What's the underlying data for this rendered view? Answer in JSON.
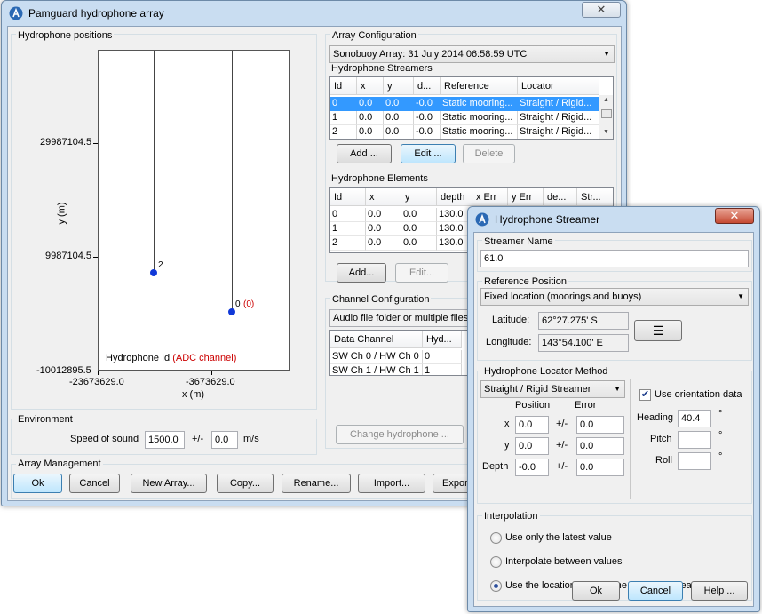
{
  "main_window": {
    "title": "Pamguard hydrophone array",
    "close_glyph": "✕",
    "hydrophone_positions": {
      "group_label": "Hydrophone positions",
      "y_ticks": [
        "29987104.5",
        "9987104.5",
        "-10012895.5"
      ],
      "x_ticks": [
        "-23673629.0",
        "-3673629.0"
      ],
      "ylabel": "y (m)",
      "xlabel": "x (m)",
      "legend_prefix": "Hydrophone Id ",
      "legend_channel": "(ADC channel)",
      "legend_channel_color": "#cc0000",
      "point_labels": [
        "2",
        "0"
      ],
      "point_channel_label": "(0)",
      "point_color": "#1038d8"
    },
    "environment": {
      "group_label": "Environment",
      "speed_label": "Speed of sound",
      "speed_value": "1500.0",
      "plusminus": "+/-",
      "speed_error": "0.0",
      "unit": "m/s"
    },
    "array_configuration": {
      "group_label": "Array Configuration",
      "selected_array": "Sonobuoy Array: 31 July 2014 06:58:59 UTC"
    },
    "streamers": {
      "group_label": "Hydrophone Streamers",
      "columns": [
        "Id",
        "x",
        "y",
        "d...",
        "Reference",
        "Locator"
      ],
      "rows": [
        [
          "0",
          "0.0",
          "0.0",
          "-0.0",
          "Static mooring...",
          "Straight / Rigid..."
        ],
        [
          "1",
          "0.0",
          "0.0",
          "-0.0",
          "Static mooring...",
          "Straight / Rigid..."
        ],
        [
          "2",
          "0.0",
          "0.0",
          "-0.0",
          "Static mooring...",
          "Straight / Rigid..."
        ]
      ],
      "add_label": "Add ...",
      "edit_label": "Edit ...",
      "delete_label": "Delete"
    },
    "elements": {
      "group_label": "Hydrophone Elements",
      "columns": [
        "Id",
        "x",
        "y",
        "depth",
        "x Err",
        "y Err",
        "de...",
        "Str..."
      ],
      "rows": [
        [
          "0",
          "0.0",
          "0.0",
          "130.0"
        ],
        [
          "1",
          "0.0",
          "0.0",
          "130.0"
        ],
        [
          "2",
          "0.0",
          "0.0",
          "130.0"
        ]
      ],
      "add_label": "Add...",
      "edit_label": "Edit..."
    },
    "channels": {
      "group_label": "Channel Configuration",
      "source": "Audio file folder or multiple files",
      "columns": [
        "Data Channel",
        "Hyd..."
      ],
      "rows": [
        [
          "SW Ch 0 / HW Ch 0",
          "0"
        ],
        [
          "SW Ch 1 / HW Ch 1",
          "1"
        ]
      ],
      "change_label": "Change hydrophone ..."
    },
    "array_management": {
      "group_label": "Array Management",
      "buttons": [
        "Ok",
        "Cancel",
        "New Array...",
        "Copy...",
        "Rename...",
        "Import...",
        "Expor"
      ]
    }
  },
  "streamer_dialog": {
    "title": "Hydrophone Streamer",
    "close_glyph": "✕",
    "name_group": "Streamer Name",
    "name_value": "61.0",
    "reference_group": "Reference Position",
    "reference_value": "Fixed location (moorings and buoys)",
    "latitude_label": "Latitude:",
    "latitude_value": "62°27.275' S",
    "longitude_label": "Longitude:",
    "longitude_value": "143°54.100' E",
    "locator_group": "Hydrophone Locator Method",
    "locator_value": "Straight / Rigid Streamer",
    "position_label": "Position",
    "error_label": "Error",
    "x_label": "x",
    "y_label": "y",
    "depth_label": "Depth",
    "plusminus": "+/-",
    "x_value": "0.0",
    "x_error": "0.0",
    "y_value": "0.0",
    "y_error": "0.0",
    "depth_value": "-0.0",
    "depth_error": "0.0",
    "use_orientation_label": "Use orientation data",
    "use_orientation_checked": true,
    "heading_label": "Heading",
    "heading_value": "40.4",
    "pitch_label": "Pitch",
    "pitch_value": "",
    "roll_label": "Roll",
    "roll_value": "",
    "degree": "°",
    "interpolation_group": "Interpolation",
    "interp_options": [
      "Use only the latest value",
      "Interpolate between values",
      "Use the location for the time preceeding each data unit"
    ],
    "interp_selected": 2,
    "ok_label": "Ok",
    "cancel_label": "Cancel",
    "help_label": "Help ..."
  }
}
